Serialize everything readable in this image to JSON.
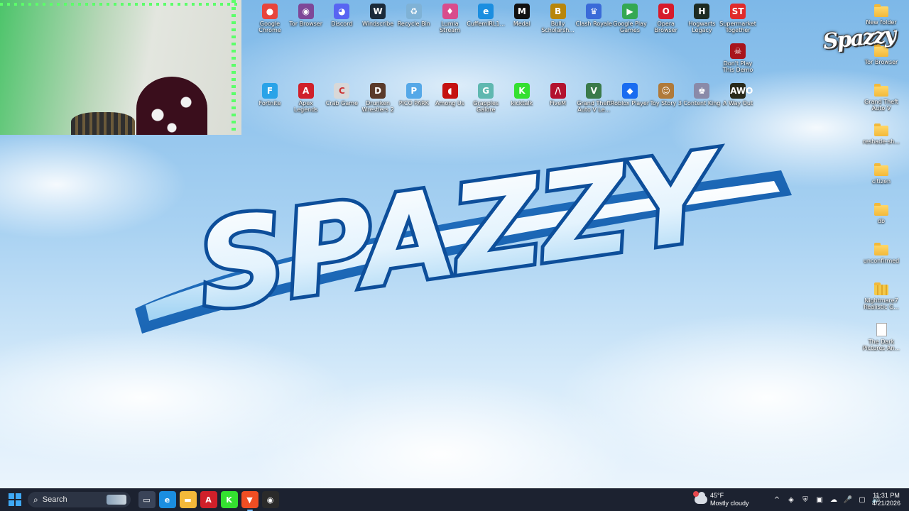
{
  "desktop": {
    "top_row": [
      {
        "label": "Google\nChrome",
        "icon": "chrome-icon",
        "color": "#e8453c",
        "glyph": "●"
      },
      {
        "label": "Tor Browser",
        "icon": "tor-icon",
        "color": "#7e4798",
        "glyph": "◉"
      },
      {
        "label": "Discord",
        "icon": "discord-icon",
        "color": "#5865f2",
        "glyph": "◕"
      },
      {
        "label": "Windscribe",
        "icon": "windscribe-icon",
        "color": "#1b2a3a",
        "glyph": "W"
      },
      {
        "label": "Recycle Bin",
        "icon": "recycle-bin-icon",
        "color": "#7fb2d6",
        "glyph": "♻"
      },
      {
        "label": "Lumia\nStream",
        "icon": "lumia-stream-icon",
        "color": "#d94c8c",
        "glyph": "♦"
      },
      {
        "label": "CuffemIRL1...",
        "icon": "edge-icon",
        "color": "#1b8ee0",
        "glyph": "e"
      },
      {
        "label": "Medal",
        "icon": "medal-icon",
        "color": "#111111",
        "glyph": "M"
      },
      {
        "label": "Bully\nScholarsh...",
        "icon": "bully-icon",
        "color": "#b8860b",
        "glyph": "B"
      },
      {
        "label": "Clash Royale",
        "icon": "clash-royale-icon",
        "color": "#3a6ad8",
        "glyph": "♛"
      },
      {
        "label": "Google Play\nGames",
        "icon": "google-play-games-icon",
        "color": "#34a853",
        "glyph": "▶"
      },
      {
        "label": "Opera\nBrowser",
        "icon": "opera-icon",
        "color": "#d61b2c",
        "glyph": "O"
      },
      {
        "label": "Hogwarts\nLegacy",
        "icon": "hogwarts-legacy-icon",
        "color": "#1d2b22",
        "glyph": "H"
      },
      {
        "label": "Supermarket\nTogether",
        "icon": "supermarket-together-icon",
        "color": "#e02b2b",
        "glyph": "ST"
      }
    ],
    "second_top": [
      {
        "label": "Don't Play\nThis Demo",
        "icon": "dont-play-demo-icon",
        "color": "#a8141c",
        "glyph": "☠"
      }
    ],
    "middle_row": [
      {
        "label": "Fortnite",
        "icon": "fortnite-icon",
        "color": "#2aa3e8",
        "glyph": "F"
      },
      {
        "label": "Apex\nLegends",
        "icon": "apex-legends-icon",
        "color": "#d0202a",
        "glyph": "A"
      },
      {
        "label": "Crab Game",
        "icon": "crab-game-icon",
        "color": "#d8d8d8",
        "glyph": "C"
      },
      {
        "label": "Drunken\nWrestlers 2",
        "icon": "drunken-wrestlers-icon",
        "color": "#5a3a2a",
        "glyph": "D"
      },
      {
        "label": "PICO PARK",
        "icon": "pico-park-icon",
        "color": "#55a8e8",
        "glyph": "P"
      },
      {
        "label": "Among Us",
        "icon": "among-us-icon",
        "color": "#c51111",
        "glyph": "◖"
      },
      {
        "label": "Grapples\nGalore",
        "icon": "grapples-galore-icon",
        "color": "#5fb8b0",
        "glyph": "G"
      },
      {
        "label": "kicktalk",
        "icon": "kicktalk-icon",
        "color": "#34e030",
        "glyph": "K"
      },
      {
        "label": "FiveM",
        "icon": "fivem-icon",
        "color": "#b3122e",
        "glyph": "/\\"
      },
      {
        "label": "Grand Theft\nAuto V Le...",
        "icon": "gta-v-icon",
        "color": "#3a7a4a",
        "glyph": "V"
      },
      {
        "label": "Roblox Player",
        "icon": "roblox-icon",
        "color": "#1a6cf0",
        "glyph": "◆"
      },
      {
        "label": "Toy Story 3",
        "icon": "toy-story-icon",
        "color": "#b07a3a",
        "glyph": "☺"
      },
      {
        "label": "Content King",
        "icon": "content-king-icon",
        "color": "#8a8aa8",
        "glyph": "♚"
      },
      {
        "label": "A Way Out",
        "icon": "a-way-out-icon",
        "color": "#2a2a1a",
        "glyph": "AWO"
      }
    ],
    "right_column": [
      {
        "label": "New folder",
        "type": "folder"
      },
      {
        "label": "Tor Browser",
        "type": "folder"
      },
      {
        "label": "Grand Theft\nAuto V",
        "type": "folder"
      },
      {
        "label": "reshade-sh...",
        "type": "folder"
      },
      {
        "label": "citizen",
        "type": "folder"
      },
      {
        "label": "db",
        "type": "folder"
      },
      {
        "label": "unconfirmed",
        "type": "folder"
      },
      {
        "label": "Nightmare7\nRealistic G...",
        "type": "zip"
      },
      {
        "label": "The Dark\nPictures An...",
        "type": "file"
      }
    ]
  },
  "wallpaper": {
    "logo_text": "SPAZZY",
    "corner_logo_text": "Spazzy"
  },
  "taskbar": {
    "search_label": "Search",
    "apps": [
      {
        "name": "task-view-icon",
        "color": "#3a4458",
        "glyph": "▭",
        "active": false
      },
      {
        "name": "edge-taskbar-icon",
        "color": "#1b8ee0",
        "glyph": "e",
        "active": false
      },
      {
        "name": "file-explorer-icon",
        "color": "#f3b93a",
        "glyph": "▬",
        "active": false
      },
      {
        "name": "apex-taskbar-icon",
        "color": "#d0202a",
        "glyph": "A",
        "active": false
      },
      {
        "name": "kick-taskbar-icon",
        "color": "#34e030",
        "glyph": "K",
        "active": false
      },
      {
        "name": "brave-taskbar-icon",
        "color": "#f04e23",
        "glyph": "▼",
        "active": true
      },
      {
        "name": "obs-taskbar-icon",
        "color": "#2a2a2a",
        "glyph": "◉",
        "active": false
      }
    ],
    "weather": {
      "temp": "45°F",
      "condition": "Mostly cloudy"
    },
    "tray": [
      {
        "name": "show-hidden-icons-chevron",
        "glyph": "^"
      },
      {
        "name": "tray-app-icon",
        "glyph": "◈"
      },
      {
        "name": "tray-security-icon",
        "glyph": "⛨"
      },
      {
        "name": "tray-app2-icon",
        "glyph": "▣"
      },
      {
        "name": "tray-network-icon",
        "glyph": "☁"
      },
      {
        "name": "microphone-icon",
        "glyph": "🎤"
      },
      {
        "name": "monitor-icon",
        "glyph": "▢"
      },
      {
        "name": "volume-icon",
        "glyph": "🔊"
      }
    ],
    "clock": {
      "time": "11:31 PM",
      "date": "4/21/2026"
    }
  }
}
